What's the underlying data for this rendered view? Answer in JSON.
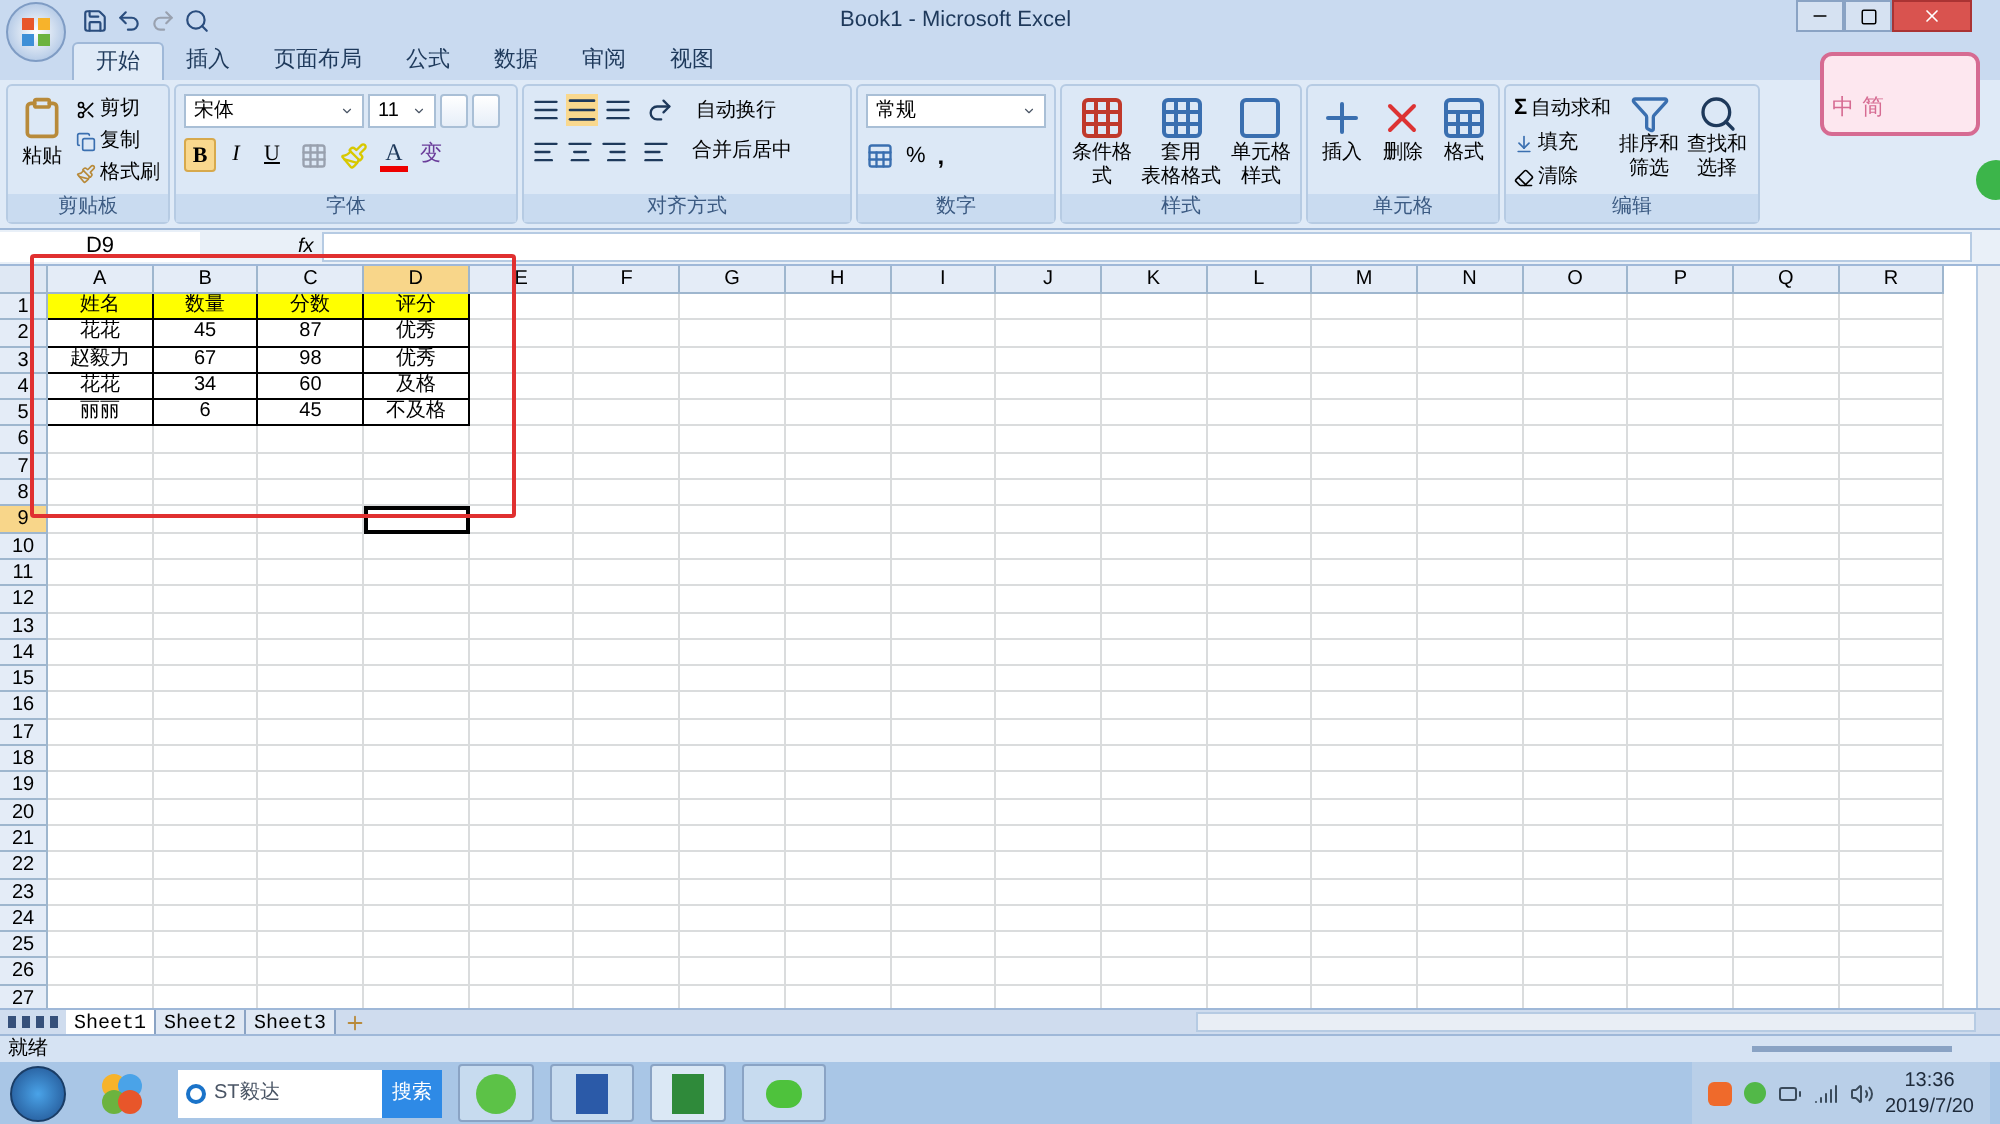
{
  "window": {
    "title": "Book1 - Microsoft Excel"
  },
  "ribbon_tabs": [
    {
      "label": "开始",
      "selected": true
    },
    {
      "label": "插入",
      "selected": false
    },
    {
      "label": "页面布局",
      "selected": false
    },
    {
      "label": "公式",
      "selected": false
    },
    {
      "label": "数据",
      "selected": false
    },
    {
      "label": "审阅",
      "selected": false
    },
    {
      "label": "视图",
      "selected": false
    }
  ],
  "clipboard": {
    "title": "剪贴板",
    "paste": "粘贴",
    "cut": "剪切",
    "copy": "复制",
    "format_painter": "格式刷"
  },
  "font": {
    "title": "字体",
    "font_name": "宋体",
    "font_size": "11",
    "bold": "B",
    "italic": "I",
    "underline": "U",
    "font_color": "A",
    "phonetic": "变"
  },
  "alignment": {
    "title": "对齐方式",
    "wrap_text": "自动换行",
    "merge_center": "合并后居中"
  },
  "number": {
    "title": "数字",
    "format": "常规",
    "percent": "%",
    "comma": ","
  },
  "styles": {
    "title": "样式",
    "buttons": [
      {
        "line1": "条件格式"
      },
      {
        "line1": "套用",
        "line2": "表格格式"
      },
      {
        "line1": "单元格",
        "line2": "样式"
      }
    ]
  },
  "cells": {
    "title": "单元格",
    "buttons": [
      {
        "label": "插入"
      },
      {
        "label": "删除"
      },
      {
        "label": "格式"
      }
    ]
  },
  "editing": {
    "title": "编辑",
    "autosum_symbol": "Σ",
    "autosum": "自动求和",
    "fill": "填充",
    "clear": "清除",
    "sort": [
      "排序和",
      "筛选"
    ],
    "find": [
      "查找和",
      "选择"
    ]
  },
  "ime": {
    "mode": "中",
    "script": "简"
  },
  "formula_bar": {
    "name_box": "D9",
    "fx": "fx"
  },
  "columns": [
    {
      "label": "A",
      "selected": false
    },
    {
      "label": "B",
      "selected": false
    },
    {
      "label": "C",
      "selected": false
    },
    {
      "label": "D",
      "selected": true
    },
    {
      "label": "E",
      "selected": false
    },
    {
      "label": "F",
      "selected": false
    },
    {
      "label": "G",
      "selected": false
    },
    {
      "label": "H",
      "selected": false
    },
    {
      "label": "I",
      "selected": false
    },
    {
      "label": "J",
      "selected": false
    },
    {
      "label": "K",
      "selected": false
    },
    {
      "label": "L",
      "selected": false
    },
    {
      "label": "M",
      "selected": false
    },
    {
      "label": "N",
      "selected": false
    },
    {
      "label": "O",
      "selected": false
    },
    {
      "label": "P",
      "selected": false
    },
    {
      "label": "Q",
      "selected": false
    },
    {
      "label": "R",
      "selected": false
    }
  ],
  "rows": [
    {
      "label": "1",
      "selected": false,
      "kind": "header",
      "cells": [
        "姓名",
        "数量",
        "分数",
        "评分"
      ]
    },
    {
      "label": "2",
      "selected": false,
      "kind": "data",
      "cells": [
        "花花",
        "45",
        "87",
        "优秀"
      ]
    },
    {
      "label": "3",
      "selected": false,
      "kind": "data",
      "cells": [
        "赵毅力",
        "67",
        "98",
        "优秀"
      ]
    },
    {
      "label": "4",
      "selected": false,
      "kind": "data",
      "cells": [
        "花花",
        "34",
        "60",
        "及格"
      ]
    },
    {
      "label": "5",
      "selected": false,
      "kind": "data",
      "cells": [
        "丽丽",
        "6",
        "45",
        "不及格"
      ]
    },
    {
      "label": "6",
      "selected": false
    },
    {
      "label": "7",
      "selected": false
    },
    {
      "label": "8",
      "selected": false
    },
    {
      "label": "9",
      "selected": true
    },
    {
      "label": "10",
      "selected": false
    },
    {
      "label": "11",
      "selected": false
    },
    {
      "label": "12",
      "selected": false
    },
    {
      "label": "13",
      "selected": false
    },
    {
      "label": "14",
      "selected": false
    },
    {
      "label": "15",
      "selected": false
    },
    {
      "label": "16",
      "selected": false
    },
    {
      "label": "17",
      "selected": false
    },
    {
      "label": "18",
      "selected": false
    },
    {
      "label": "19",
      "selected": false
    },
    {
      "label": "20",
      "selected": false
    },
    {
      "label": "21",
      "selected": false
    },
    {
      "label": "22",
      "selected": false
    },
    {
      "label": "23",
      "selected": false
    },
    {
      "label": "24",
      "selected": false
    },
    {
      "label": "25",
      "selected": false
    },
    {
      "label": "26",
      "selected": false
    },
    {
      "label": "27",
      "selected": false
    }
  ],
  "sheet_tabs": [
    {
      "label": "Sheet1",
      "selected": true
    },
    {
      "label": "Sheet2",
      "selected": false
    },
    {
      "label": "Sheet3",
      "selected": false
    }
  ],
  "status_bar": {
    "text": "就绪"
  },
  "taskbar": {
    "search_value": "ST毅达",
    "search_button": "搜索",
    "time": "13:36",
    "date": "2019/7/20"
  }
}
